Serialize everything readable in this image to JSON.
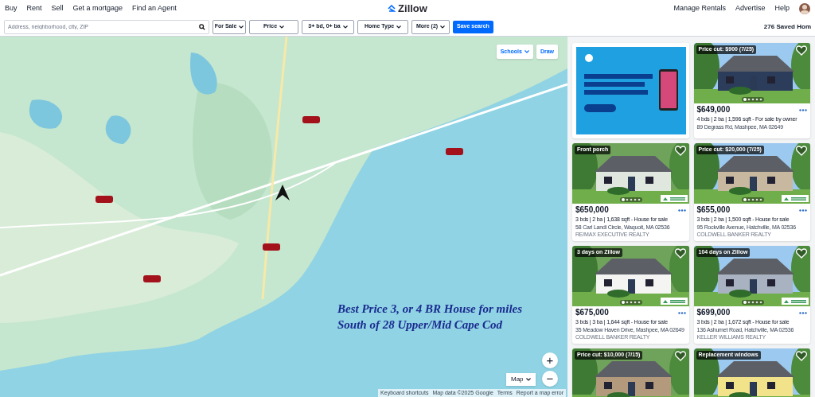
{
  "nav": {
    "links": [
      "Buy",
      "Rent",
      "Sell",
      "Get a mortgage",
      "Find an Agent"
    ],
    "logo": "Zillow",
    "right_links": [
      "Manage Rentals",
      "Advertise",
      "Help"
    ]
  },
  "filters": {
    "search_placeholder": "Address, neighborhood, city, ZIP",
    "dropdowns": [
      "For Sale",
      "Price",
      "3+ bd, 0+ ba",
      "Home Type",
      "More (2)"
    ],
    "save_button": "Save search",
    "saved_count": "276 Saved Hom"
  },
  "map": {
    "layers_button": "Schools",
    "draw_button": "Draw",
    "zoom_in": "+",
    "zoom_out": "−",
    "type_button": "Map",
    "attribution": [
      "Keyboard shortcuts",
      "Map data ©2025 Google",
      "Terms",
      "Report a map error"
    ],
    "annotation": [
      "Best Price 3, or 4 BR House for miles",
      "South of 28 Upper/Mid Cape Cod"
    ]
  },
  "listings": [
    {
      "kind": "ad"
    },
    {
      "kind": "home",
      "badge": "Price cut: $900 (7/25)",
      "price": "$649,000",
      "details": "4 bds | 2 ba | 1,596 sqft - For sale by owner",
      "address": "89 Degrass Rd, Mashpee, MA 02649",
      "broker_logo": false
    },
    {
      "kind": "home",
      "badge": "Front porch",
      "price": "$650,000",
      "details": "3 bds | 2 ba | 1,638 sqft - House for sale",
      "address": "58 Carl Landi Circle, Waquoit, MA 02536",
      "broker": "RE/MAX EXECUTIVE REALTY",
      "broker_logo": true
    },
    {
      "kind": "home",
      "badge": "Price cut: $20,000 (7/25)",
      "price": "$655,000",
      "details": "3 bds | 2 ba | 1,500 sqft - House for sale",
      "address": "95 Rockville Avenue, Hatchville, MA 02536",
      "broker": "COLDWELL BANKER REALTY",
      "broker_logo": true
    },
    {
      "kind": "home",
      "badge": "3 days on Zillow",
      "price": "$675,000",
      "details": "3 bds | 3 ba | 1,644 sqft - House for sale",
      "address": "35 Meadow Haven Drive, Mashpee, MA 02649",
      "broker": "COLDWELL BANKER REALTY",
      "broker_logo": true
    },
    {
      "kind": "home",
      "badge": "104 days on Zillow",
      "price": "$699,000",
      "details": "3 bds | 2 ba | 1,672 sqft - House for sale",
      "address": "136 Ashumet Road, Hatchville, MA 02536",
      "broker": "KELLER WILLIAMS REALTY",
      "broker_logo": true
    },
    {
      "kind": "home",
      "badge": "Price cut: $10,000 (7/15)",
      "broker_logo": false
    },
    {
      "kind": "home",
      "badge": "Replacement windows",
      "broker_logo": false
    }
  ]
}
